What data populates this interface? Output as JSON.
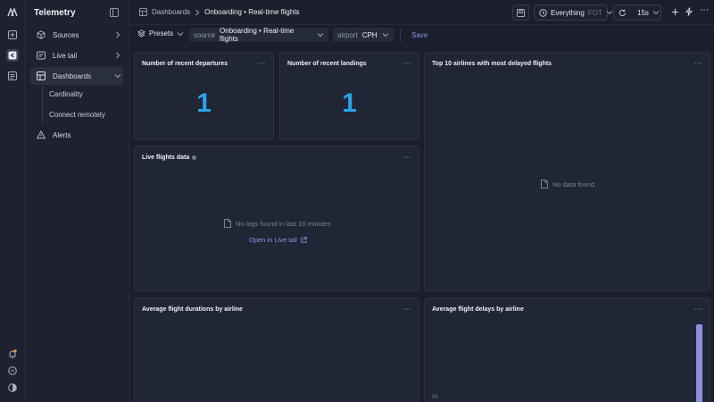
{
  "app": {
    "name": "Telemetry"
  },
  "sidebar": {
    "items": [
      {
        "label": "Sources",
        "icon": "box-icon"
      },
      {
        "label": "Live tail",
        "icon": "live-tail-icon"
      },
      {
        "label": "Dashboards",
        "icon": "dashboard-icon"
      },
      {
        "label": "Alerts",
        "icon": "alert-icon"
      }
    ],
    "dashboards_sub": [
      {
        "label": "Cardinality"
      },
      {
        "label": "Connect remotely"
      }
    ]
  },
  "header": {
    "breadcrumbs": [
      "Dashboards",
      "Onboarding • Real-time flights"
    ],
    "time_range": "Everything",
    "time_range_suffix": "FOT",
    "refresh_interval": "15s"
  },
  "filters": {
    "presets_label": "Presets",
    "source_key": "source",
    "source_value": "Onboarding • Real-time flights",
    "airport_key": "airport",
    "airport_value": "CPH",
    "save_label": "Save"
  },
  "panels": {
    "departures": {
      "title": "Number of recent departures",
      "value": "1"
    },
    "landings": {
      "title": "Number of recent landings",
      "value": "1"
    },
    "top_airlines": {
      "title": "Top 10 airlines with most delayed flights",
      "empty": "No data found"
    },
    "live_flights": {
      "title": "Live flights data",
      "empty": "No logs found in last 10 minutes",
      "link": "Open in Live tail"
    },
    "durations": {
      "title": "Average flight durations by airline"
    },
    "delays": {
      "title": "Average flight delays by airline",
      "y_tick": "5K"
    }
  },
  "colors": {
    "accent": "#2aa4e6",
    "link": "#8a94e8",
    "bar": "#8d90e0",
    "background": "#1b1f2b"
  }
}
